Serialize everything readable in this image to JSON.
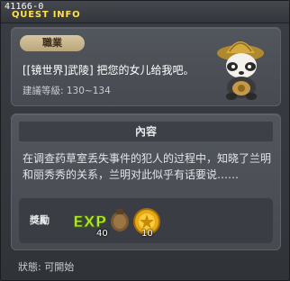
{
  "window": {
    "quest_id": "41166-0",
    "title": "QUEST INFO"
  },
  "job_panel": {
    "job_badge": "職業",
    "quest_line": "[[镜世界]武陵] 把您的女儿给我吧。",
    "level_label": "建議等級: 130~134"
  },
  "content_panel": {
    "header": "內容",
    "description": "在调查药草室丢失事件的犯人的过程中，知晓了兰明和丽秀秀的关系，兰明对此似乎有话要说……"
  },
  "reward": {
    "label": "獎勵",
    "exp_count": "40",
    "meso_count": "10"
  },
  "footer": {
    "status": "狀態: 可開始"
  },
  "colors": {
    "title_yellow": "#ffe04a",
    "panel_bg": "#4e5258",
    "badge": "#c8b58c"
  },
  "icons": [
    "panda-npc-icon",
    "exp-icon",
    "meso-coin-icon"
  ]
}
